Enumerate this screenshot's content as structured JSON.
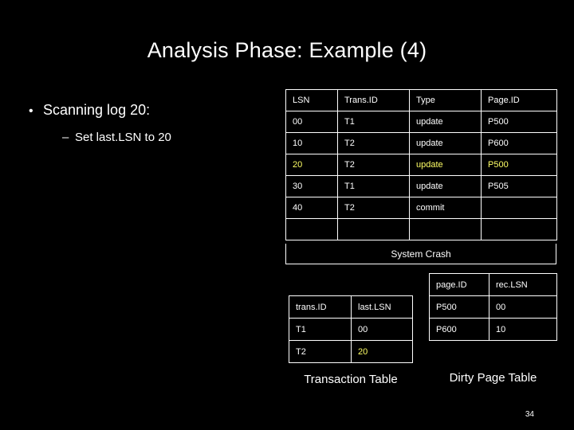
{
  "slide": {
    "title": "Analysis Phase: Example (4)",
    "bullet_main": "Scanning log 20:",
    "bullet_sub": "Set last.LSN to 20",
    "page_number": "34",
    "accent_color": "#ffff66",
    "background_color": "#000000"
  },
  "log_table": {
    "headers": [
      "LSN",
      "Trans.ID",
      "Type",
      "Page.ID"
    ],
    "rows": [
      {
        "lsn": "00",
        "transid": "T1",
        "type": "update",
        "pageid": "P500",
        "highlight": false
      },
      {
        "lsn": "10",
        "transid": "T2",
        "type": "update",
        "pageid": "P600",
        "highlight": false
      },
      {
        "lsn": "20",
        "transid": "T2",
        "type": "update",
        "pageid": "P500",
        "highlight": true
      },
      {
        "lsn": "30",
        "transid": "T1",
        "type": "update",
        "pageid": "P505",
        "highlight": false
      },
      {
        "lsn": "40",
        "transid": "T2",
        "type": "commit",
        "pageid": "",
        "highlight": false
      },
      {
        "lsn": "",
        "transid": "",
        "type": "",
        "pageid": "",
        "highlight": false
      }
    ],
    "crash_label": "System Crash"
  },
  "transaction_table": {
    "headers": [
      "trans.ID",
      "last.LSN"
    ],
    "rows": [
      {
        "transid": "T1",
        "lastlsn": "00",
        "highlight": false
      },
      {
        "transid": "T2",
        "lastlsn": "20",
        "highlight": true
      }
    ],
    "caption": "Transaction Table"
  },
  "dirty_page_table": {
    "headers": [
      "page.ID",
      "rec.LSN"
    ],
    "rows": [
      {
        "pageid": "P500",
        "reclsn": "00"
      },
      {
        "pageid": "P600",
        "reclsn": "10"
      }
    ],
    "caption": "Dirty Page Table"
  }
}
